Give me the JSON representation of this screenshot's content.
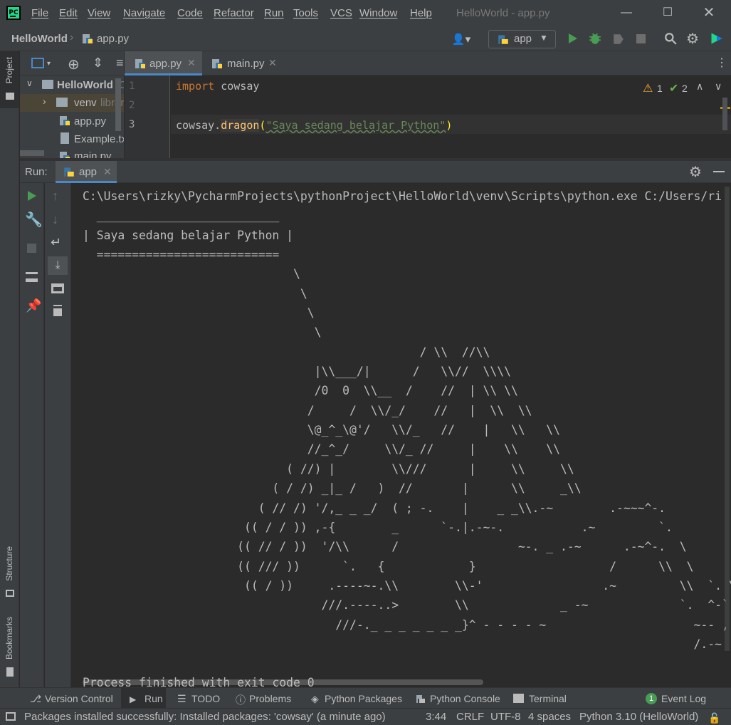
{
  "app": {
    "logo_text": "PC"
  },
  "menu": [
    "File",
    "Edit",
    "View",
    "Navigate",
    "Code",
    "Refactor",
    "Run",
    "Tools",
    "VCS",
    "Window",
    "Help"
  ],
  "window_title": "HelloWorld - app.py",
  "breadcrumb": {
    "project": "HelloWorld",
    "file": "app.py"
  },
  "run_config": "app",
  "side_tabs": {
    "project": "Project",
    "structure": "Structure",
    "bookmarks": "Bookmarks"
  },
  "project_tree": {
    "root": "HelloWorld",
    "root_suffix": "C",
    "items": [
      {
        "label": "venv",
        "suffix": "librar"
      },
      {
        "label": "app.py"
      },
      {
        "label": "Example.tx"
      },
      {
        "label": "main.py"
      }
    ]
  },
  "editor_tabs": [
    {
      "label": "app.py",
      "active": true
    },
    {
      "label": "main.py",
      "active": false
    }
  ],
  "editor": {
    "line_numbers": [
      "1",
      "2",
      "3"
    ],
    "line1_kw": "import",
    "line1_rest": " cowsay",
    "line3_obj": "cowsay.",
    "line3_fn": "dragon",
    "line3_open": "(",
    "line3_str": "\"Saya sedang belajar Python\"",
    "line3_close": ")",
    "warnings": "1",
    "weak_warnings": "2"
  },
  "run_panel": {
    "label": "Run:",
    "tab": "app",
    "console_lines": [
      "C:\\Users\\rizky\\PycharmProjects\\pythonProject\\HelloWorld\\venv\\Scripts\\python.exe C:/Users/ri",
      "  __________________________",
      "| Saya sedang belajar Python |",
      "  ==========================",
      "                              \\",
      "                               \\",
      "                                \\",
      "                                 \\",
      "                                                / \\\\  //\\\\",
      "                                 |\\\\___/|      /   \\\\//  \\\\\\\\",
      "                                 /0  0  \\\\__  /    //  | \\\\ \\\\",
      "                                /     /  \\\\/_/    //   |  \\\\  \\\\",
      "                                \\@_^_\\@'/   \\\\/_   //    |   \\\\   \\\\",
      "                                //_^_/     \\\\/_ //     |    \\\\    \\\\",
      "                             ( //) |        \\\\///      |     \\\\     \\\\",
      "                           ( / /) _|_ /   )  //       |      \\\\     _\\\\",
      "                         ( // /) '/,_ _ _/  ( ; -.    |    _ _\\\\.-~        .-~~~^-.",
      "                       (( / / )) ,-{        _      `-.|.-~-.           .~         `.",
      "                      (( // / ))  '/\\\\      /                 ~-. _ .-~      .-~^-.  \\",
      "                      (( /// ))      `.   {            }                   /      \\\\  \\",
      "                       (( / ))     .----~-.\\\\        \\\\-'                 .~         \\\\  `. \\^-.",
      "                                  ///.----..>        \\\\             _ -~             `.  ^-`  ^-_",
      "                                    ///-._ _ _ _ _ _ _}^ - - - - ~                     ~-- ,.-~",
      "                                                                                       /.-~"
    ],
    "exit_message": "Process finished with exit code 0"
  },
  "bottom_tabs": [
    "Version Control",
    "Run",
    "TODO",
    "Problems",
    "Python Packages",
    "Python Console",
    "Terminal"
  ],
  "event_log": {
    "count": "1",
    "label": "Event Log"
  },
  "status": {
    "message": "Packages installed successfully: Installed packages: 'cowsay' (a minute ago)",
    "position": "3:44",
    "line_sep": "CRLF",
    "encoding": "UTF-8",
    "indent": "4 spaces",
    "interpreter": "Python 3.10 (HelloWorld)"
  },
  "colors": {
    "accent": "#4a88c7",
    "run_green": "#499c54",
    "keyword": "#cc7832",
    "function": "#ffc66d",
    "string": "#6a8759",
    "warning": "#f0a732"
  }
}
